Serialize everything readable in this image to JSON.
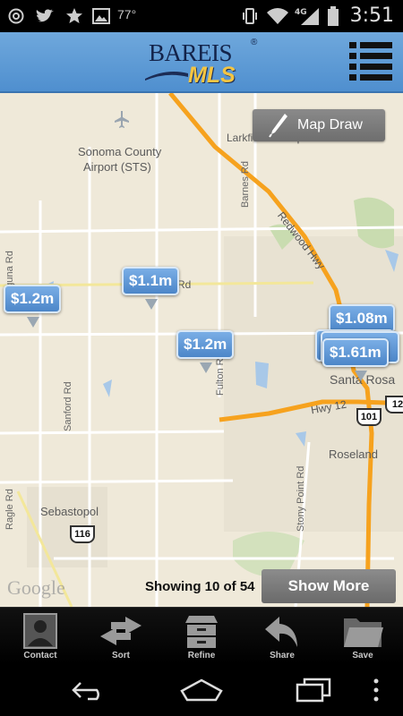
{
  "status_bar": {
    "temperature": "77°",
    "time": "3:51",
    "network": "4G"
  },
  "header": {
    "logo_brand": "BAREIS",
    "logo_registered": "®",
    "logo_sub": "MLS",
    "menu_icon": "list-menu-icon"
  },
  "map": {
    "map_draw_label": "Map Draw",
    "labels": {
      "airport": "Sonoma County",
      "airport2": "Airport (STS)",
      "larkfield": "Larkfield-Wikiup",
      "barnes_rd": "Barnes Rd",
      "redwood_hwy": "Redwood Hwy",
      "santa_rosa": "Santa Rosa",
      "hwy12": "Hwy 12",
      "roseland": "Roseland",
      "sanford_rd": "Sanford Rd",
      "fulton_rd": "Fulton Rd",
      "stony_point_rd": "Stony Point Rd",
      "sebastopol": "Sebastopol",
      "ragle_rd": "Ragle Rd",
      "laguna_rd": "Laguna Rd",
      "rd_fragment": "Rd",
      "hwy_101": "101",
      "hwy_116": "116",
      "hwy_12_shield": "12",
      "google": "Google"
    },
    "pins": [
      {
        "price": "$1.2m"
      },
      {
        "price": "$1.1m"
      },
      {
        "price": "$1.2m"
      },
      {
        "price": "$1.08m"
      },
      {
        "price": "$1.61m"
      }
    ]
  },
  "results": {
    "showing_text": "Showing 10 of 54",
    "show_more_label": "Show More"
  },
  "toolbar": {
    "items": [
      {
        "label": "Contact",
        "icon": "contact-icon"
      },
      {
        "label": "Sort",
        "icon": "sort-arrows-icon"
      },
      {
        "label": "Refine",
        "icon": "filing-cabinet-icon"
      },
      {
        "label": "Share",
        "icon": "share-arrow-icon"
      },
      {
        "label": "Save",
        "icon": "folder-icon"
      }
    ]
  },
  "colors": {
    "header_blue": "#5b9bd5",
    "pin_blue": "#5b93d1",
    "highway_orange": "#f6a21e",
    "map_bg": "#efe9d9"
  }
}
